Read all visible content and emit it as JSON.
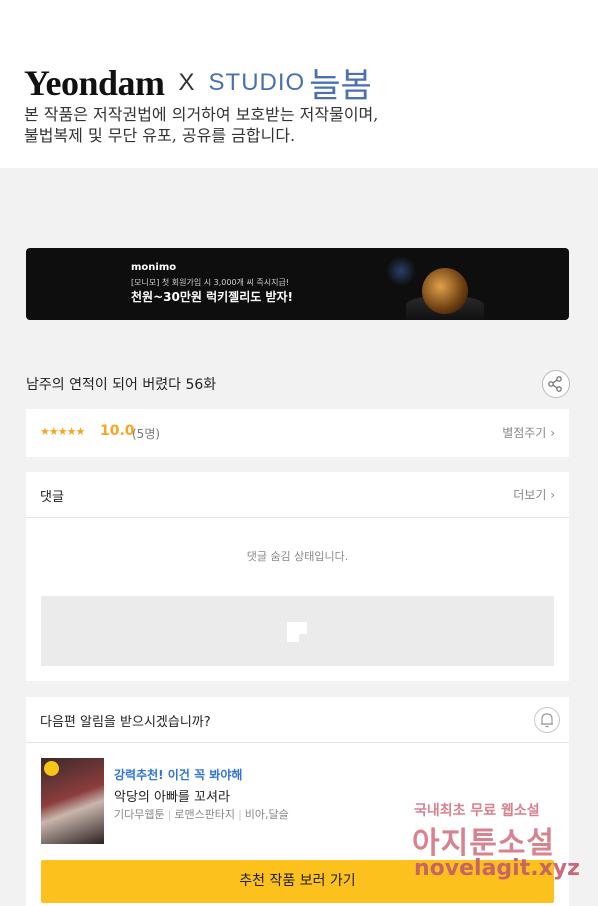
{
  "header": {
    "brand_left": "Yeondam",
    "brand_x": "X",
    "brand_studio": "STUDIO",
    "brand_korean": "늘봄",
    "notice_line1": "본 작품은 저작권법에 의거하여 보호받는 저작물이며,",
    "notice_line2": "불법복제 및 무단 유포, 공유를 금합니다."
  },
  "banner": {
    "brand": "monimo",
    "line1": "[모니모] 첫 회원가입 시 3,000개 씨 즉시지급!",
    "line2": "천원~30만원 럭키젤리도 받자!"
  },
  "episode": {
    "title": "남주의 연적이 되어 버렸다 56화",
    "share_icon": "share-icon"
  },
  "rating": {
    "stars": "★★★★★",
    "score": "10.0",
    "count": "(5명)",
    "rate_link": "별점주기",
    "chevron": "›"
  },
  "comments": {
    "title": "댓글",
    "more": "더보기",
    "chevron": "›",
    "hidden_message": "댓글 숨김 상태입니다."
  },
  "notify": {
    "question": "다음편 알림을 받으시겠습니까?",
    "bell_icon": "bell-icon",
    "recommend_label": "강력추천! 이건 꼭 봐야해",
    "recommend_title": "악당의 아빠를 꼬셔라",
    "tags": [
      "기다무웹툰",
      "로맨스판타지",
      "비아,달슬"
    ],
    "cta": "추천 작품 보러 가기"
  },
  "watermark": {
    "line1": "국내최초 무료 웹소설",
    "line2": "아지툰소설",
    "line3": "novelagit.xyz"
  },
  "colors": {
    "accent_yellow": "#fcc11d",
    "star": "#f5a623",
    "recommend_blue": "#2f74d6",
    "studio_blue": "#4b6fb3"
  }
}
